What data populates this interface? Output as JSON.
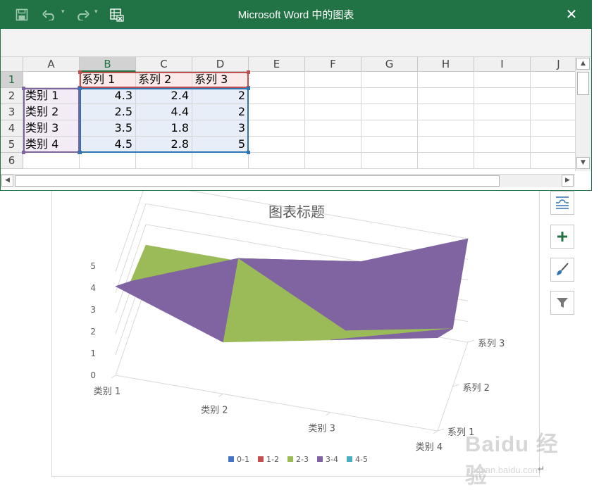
{
  "window": {
    "title": "Microsoft Word 中的图表",
    "titlebar_color": "#217346",
    "toolbar": {
      "save_icon": "save-icon",
      "undo_icon": "undo-icon",
      "redo_icon": "redo-icon",
      "edit_data_icon": "edit-data-in-excel-icon",
      "close_glyph": "✕"
    }
  },
  "sheet": {
    "columns": [
      "A",
      "B",
      "C",
      "D",
      "E",
      "F",
      "G",
      "H",
      "I",
      "J"
    ],
    "rows": [
      "1",
      "2",
      "3",
      "4",
      "5",
      "6"
    ],
    "cells": [
      [
        "",
        "系列 1",
        "系列 2",
        "系列 3"
      ],
      [
        "类别 1",
        "4.3",
        "2.4",
        "2"
      ],
      [
        "类别 2",
        "2.5",
        "4.4",
        "2"
      ],
      [
        "类别 3",
        "3.5",
        "1.8",
        "3"
      ],
      [
        "类别 4",
        "4.5",
        "2.8",
        "5"
      ]
    ]
  },
  "chart": {
    "title": "图表标题",
    "z_ticks": [
      "5",
      "4",
      "3",
      "2",
      "1",
      "0"
    ],
    "category_labels": [
      "类别 1",
      "类别 2",
      "类别 3",
      "类别 4"
    ],
    "series_labels": [
      "系列 3",
      "系列 2",
      "系列 1"
    ],
    "legend": [
      "0-1",
      "1-2",
      "2-3",
      "3-4",
      "4-5"
    ],
    "legend_colors": [
      "#4472c4",
      "#c0504d",
      "#9bbb59",
      "#8064a2",
      "#4bacc6"
    ]
  },
  "chart_data": {
    "type": "surface-3d",
    "title": "图表标题",
    "categories": [
      "类别 1",
      "类别 2",
      "类别 3",
      "类别 4"
    ],
    "series": [
      {
        "name": "系列 1",
        "values": [
          4.3,
          2.5,
          3.5,
          4.5
        ]
      },
      {
        "name": "系列 2",
        "values": [
          2.4,
          4.4,
          1.8,
          2.8
        ]
      },
      {
        "name": "系列 3",
        "values": [
          2,
          2,
          3,
          5
        ]
      }
    ],
    "zlim": [
      0,
      5
    ],
    "legend_bands": [
      "0-1",
      "1-2",
      "2-3",
      "3-4",
      "4-5"
    ],
    "legend_position": "bottom"
  },
  "side_buttons": [
    "layout-options-icon",
    "chart-elements-plus-icon",
    "chart-styles-brush-icon",
    "chart-filters-icon"
  ],
  "watermark": {
    "brand": "Baidu 经验",
    "url": "jingyan.baidu.com"
  },
  "paragraph_mark": "↵"
}
